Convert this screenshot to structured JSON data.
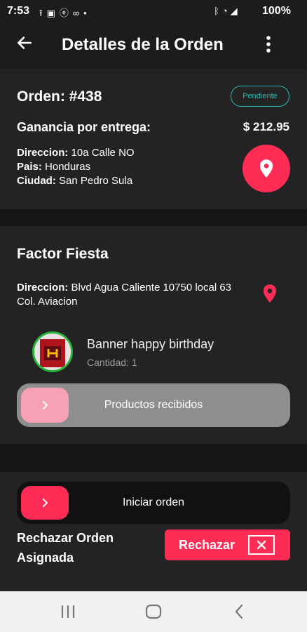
{
  "status_bar": {
    "time": "7:53",
    "notification_icons": [
      "upload-icon",
      "sim-icon",
      "e-icon",
      "dots-icon",
      "dot-icon"
    ],
    "system_icons": [
      "bluetooth-icon",
      "wifi-icon",
      "signal-icon"
    ],
    "battery": "100%"
  },
  "appbar": {
    "title": "Detalles de la Orden"
  },
  "order": {
    "label": "Orden: #438",
    "status": "Pendiente",
    "earnings_label": "Ganancia por entrega:",
    "earnings_value": "$ 212.95",
    "address_label": "Direccion:",
    "address_value": " 10a Calle NO",
    "country_label": "Pais:",
    "country_value": " Honduras",
    "city_label": "Ciudad:",
    "city_value": " San Pedro Sula"
  },
  "store": {
    "name": "Factor Fiesta",
    "address_label": "Direccion:",
    "address_value": " Blvd Agua Caliente 10750 local 63 Col. Aviacion",
    "product_name": "Banner happy birthday",
    "product_qty": "Cantidad: 1",
    "received_label": "Productos recibidos"
  },
  "actions": {
    "start_label": "Iniciar orden",
    "reject_text": "Rechazar Orden Asignada",
    "reject_button": "Rechazar"
  },
  "colors": {
    "accent": "#ff2d55",
    "badge": "#2fb6b5",
    "background": "#151515",
    "card": "#232323"
  }
}
